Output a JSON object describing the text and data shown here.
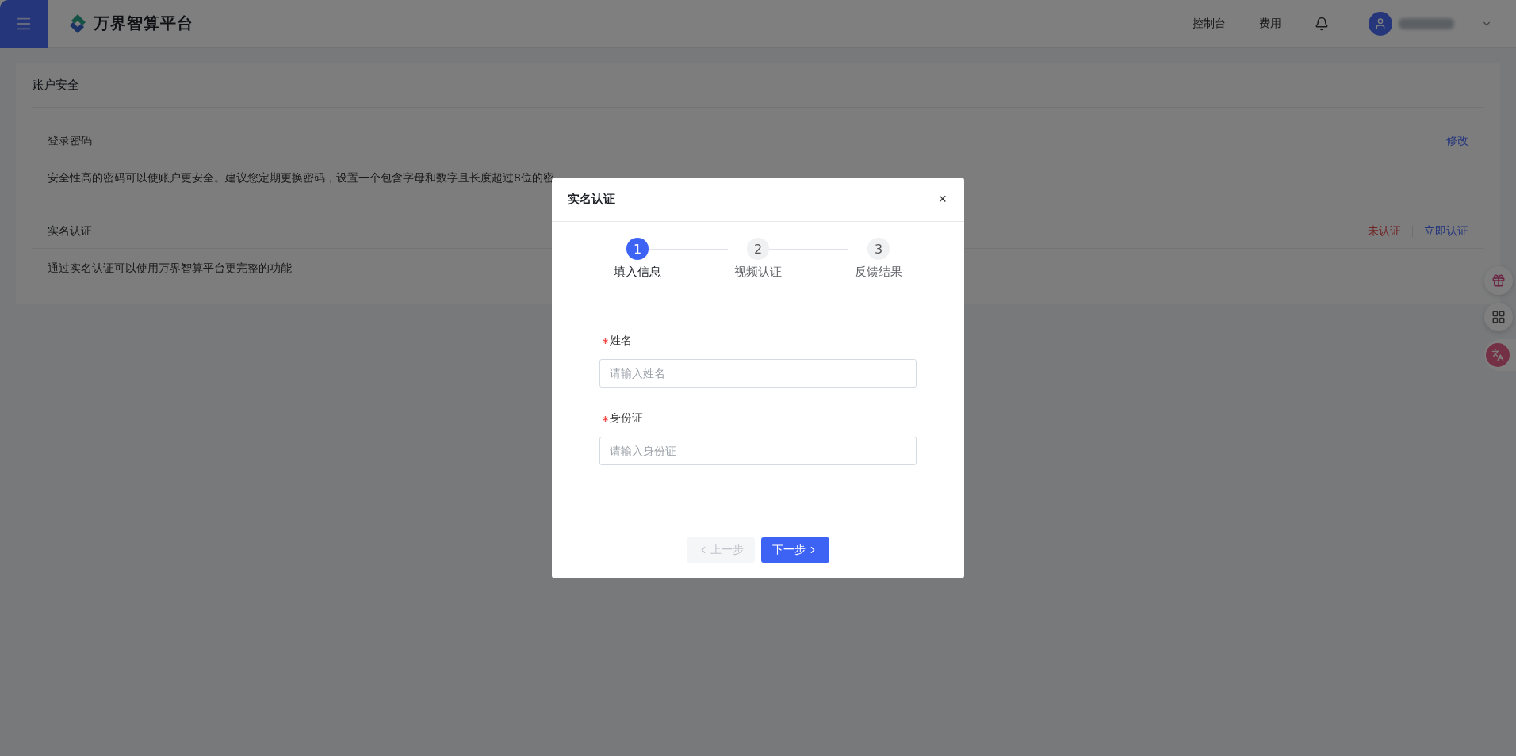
{
  "header": {
    "logo_text": "万界智算平台",
    "nav": [
      "控制台",
      "费用"
    ]
  },
  "page": {
    "title": "账户安全",
    "sections": [
      {
        "title": "登录密码",
        "description": "安全性高的密码可以使账户更安全。建议您定期更换密码，设置一个包含字母和数字且长度超过8位的密",
        "actions": [
          {
            "label": "修改",
            "kind": "link"
          }
        ]
      },
      {
        "title": "实名认证",
        "description": "通过实名认证可以使用万界智算平台更完整的功能",
        "actions": [
          {
            "label": "未认证",
            "kind": "status"
          },
          {
            "label": "立即认证",
            "kind": "link"
          }
        ]
      }
    ]
  },
  "dialog": {
    "title": "实名认证",
    "close": "×",
    "steps": [
      {
        "number": "1",
        "label": "填入信息",
        "selected": true
      },
      {
        "number": "2",
        "label": "视频认证",
        "selected": false
      },
      {
        "number": "3",
        "label": "反馈结果",
        "selected": false
      }
    ],
    "fields": [
      {
        "label": "姓名",
        "required": true,
        "placeholder": "请输入姓名"
      },
      {
        "label": "身份证",
        "required": true,
        "placeholder": "请输入身份证"
      }
    ],
    "buttons": [
      {
        "label": "上一步",
        "kind": "prev",
        "disabled": true
      },
      {
        "label": "下一步",
        "kind": "next",
        "disabled": false
      }
    ]
  }
}
